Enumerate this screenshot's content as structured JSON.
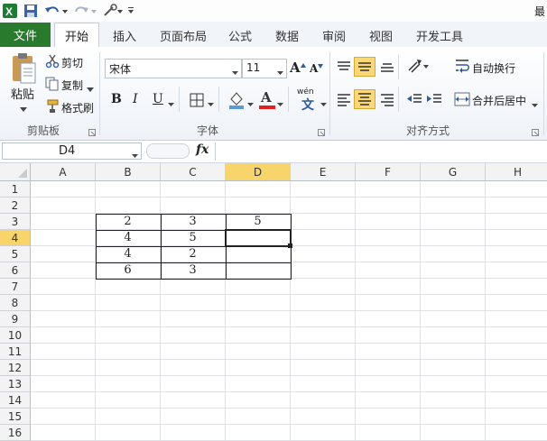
{
  "titlebar": {
    "right_text": "最"
  },
  "tabs": {
    "file": "文件",
    "items": [
      {
        "label": "开始",
        "name": "tab-home"
      },
      {
        "label": "插入",
        "name": "tab-insert"
      },
      {
        "label": "页面布局",
        "name": "tab-page-layout"
      },
      {
        "label": "公式",
        "name": "tab-formulas"
      },
      {
        "label": "数据",
        "name": "tab-data"
      },
      {
        "label": "审阅",
        "name": "tab-review"
      },
      {
        "label": "视图",
        "name": "tab-view"
      },
      {
        "label": "开发工具",
        "name": "tab-developer"
      }
    ]
  },
  "clipboard": {
    "paste": "粘贴",
    "cut": "剪切",
    "copy": "复制",
    "format_painter": "格式刷",
    "group": "剪贴板"
  },
  "font": {
    "name": "宋体",
    "size": "11",
    "bold": "B",
    "italic": "I",
    "underline": "U",
    "group": "字体",
    "font_color": "A",
    "grow": "A",
    "shrink": "A",
    "phonetic": "wén"
  },
  "alignment": {
    "wrap": "自动换行",
    "merge": "合并后居中",
    "group": "对齐方式"
  },
  "formula_bar": {
    "name_box": "D4",
    "fx": "fx",
    "value": ""
  },
  "sheet": {
    "columns": [
      "A",
      "B",
      "C",
      "D",
      "E",
      "F",
      "G",
      "H"
    ],
    "rows": [
      "1",
      "2",
      "3",
      "4",
      "5",
      "6",
      "7",
      "8",
      "9",
      "10",
      "11",
      "12",
      "13",
      "14",
      "15",
      "16"
    ],
    "selected_cell": "D4",
    "cells": {
      "B3": "2",
      "C3": "3",
      "D3": "5",
      "B4": "4",
      "C4": "5",
      "D4": "",
      "B5": "4",
      "C5": "2",
      "D5": "",
      "B6": "6",
      "C6": "3",
      "D6": ""
    }
  },
  "colors": {
    "file_tab": "#2a7a2e",
    "selection": "#217346",
    "header_highlight": "#f7d56b"
  }
}
